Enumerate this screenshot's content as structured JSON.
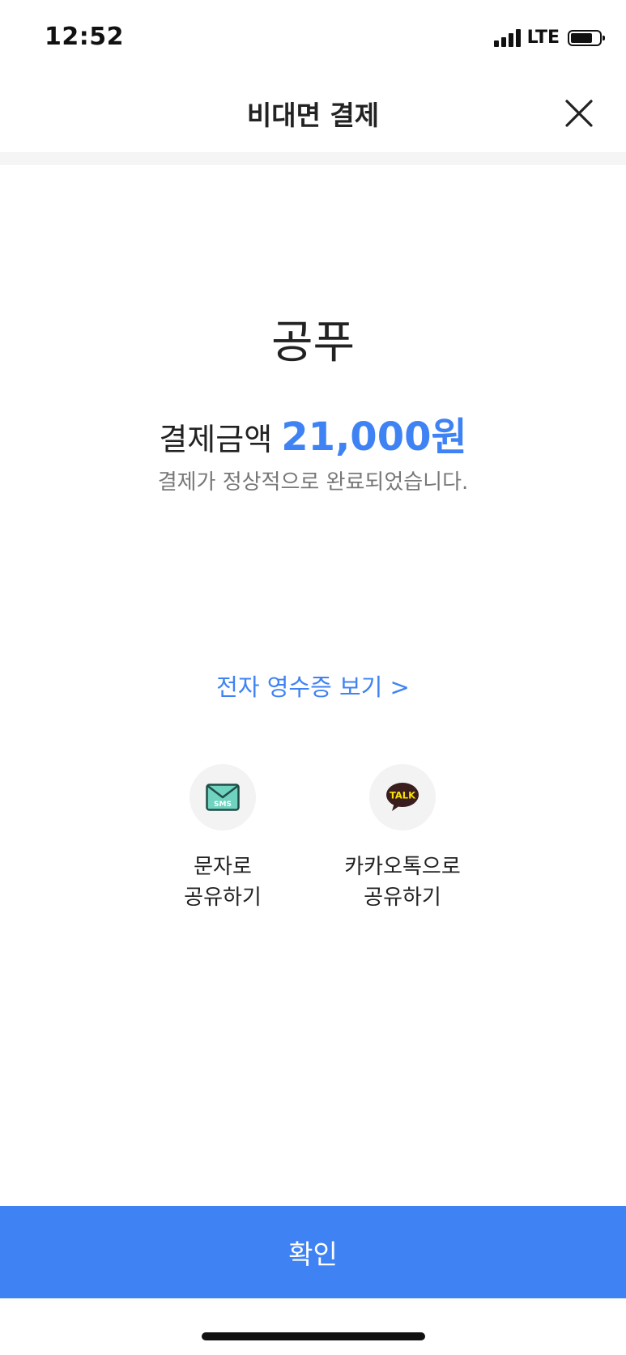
{
  "status_bar": {
    "time": "12:52",
    "network": "LTE",
    "signal_icon": "signal-bars-icon",
    "battery_icon": "battery-icon"
  },
  "header": {
    "title": "비대면 결제",
    "close_icon": "close-icon"
  },
  "payment": {
    "store_name": "공푸",
    "amount_label": "결제금액",
    "amount_value": "21,000원",
    "complete_message": "결제가 정상적으로 완료되었습니다."
  },
  "receipt": {
    "link_label": "전자 영수증 보기 >"
  },
  "share": {
    "items": [
      {
        "icon": "sms-icon",
        "icon_text": "SMS",
        "label_line1": "문자로",
        "label_line2": "공유하기"
      },
      {
        "icon": "kakaotalk-icon",
        "icon_text": "TALK",
        "label_line1": "카카오톡으로",
        "label_line2": "공유하기"
      }
    ]
  },
  "footer": {
    "confirm_label": "확인"
  },
  "colors": {
    "accent": "#3f82f3",
    "text_primary": "#222222",
    "text_secondary": "#777777",
    "band": "#f5f5f5",
    "kakao_yellow": "#fae100",
    "sms_green": "#6fd3bf"
  }
}
